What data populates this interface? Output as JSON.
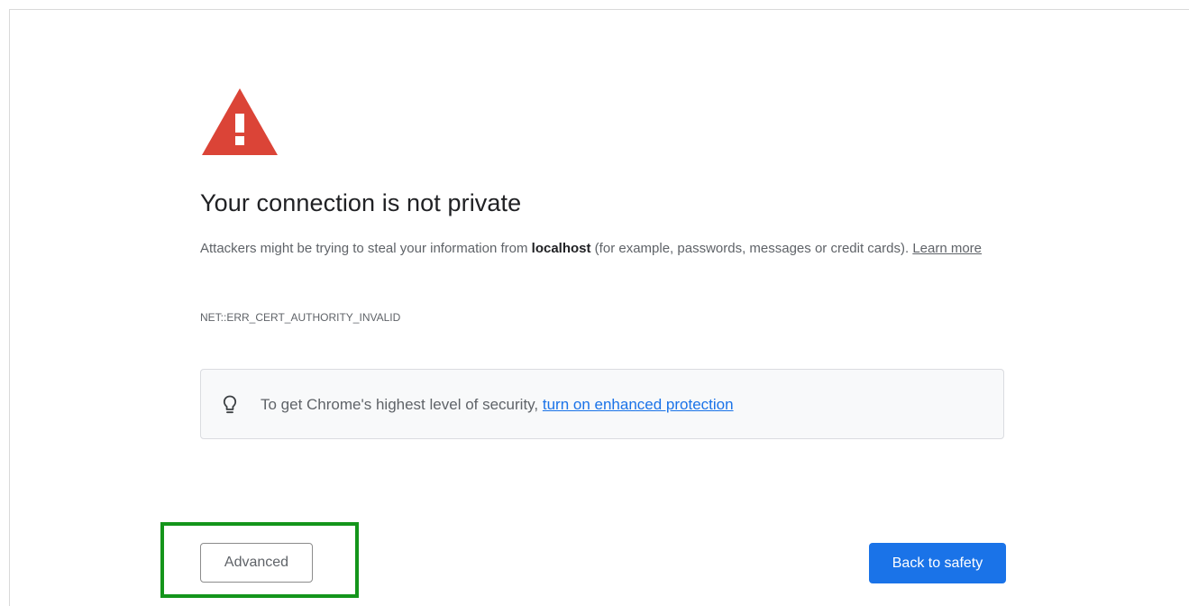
{
  "interstitial": {
    "heading": "Your connection is not private",
    "description": {
      "before_host": "Attackers might be trying to steal your information from ",
      "host": "localhost",
      "after_host": " (for example, passwords, messages or credit cards). ",
      "learn_more": "Learn more"
    },
    "error_code": "NET::ERR_CERT_AUTHORITY_INVALID",
    "enhanced_protection": {
      "text": "To get Chrome's highest level of security, ",
      "link": "turn on enhanced protection"
    },
    "buttons": {
      "advanced": "Advanced",
      "back_to_safety": "Back to safety"
    }
  },
  "icons": {
    "warning": "warning-triangle-icon",
    "bulb": "lightbulb-icon"
  },
  "colors": {
    "warning_red": "#db4437",
    "primary_blue": "#1a73e8",
    "highlight_green": "#14951b",
    "info_box_bg": "#f8f9fa"
  }
}
